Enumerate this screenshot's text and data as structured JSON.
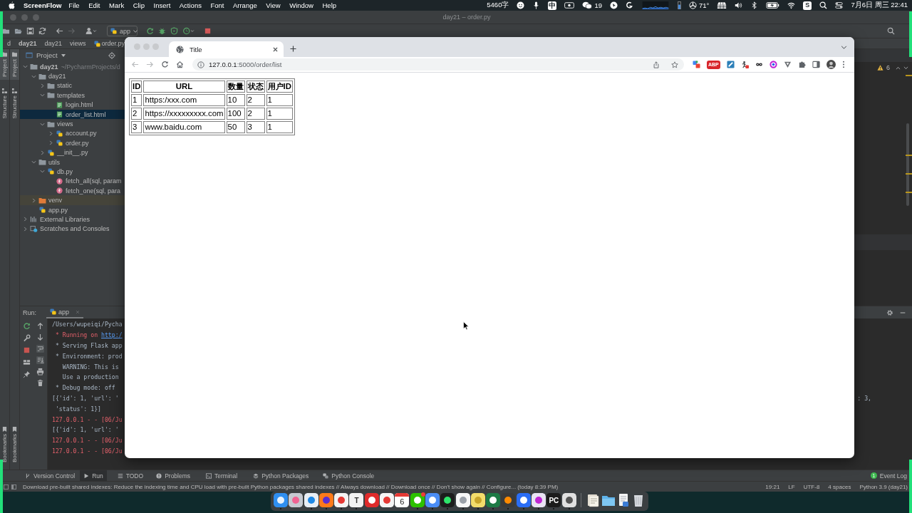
{
  "menu_bar": {
    "app_name": "ScreenFlow",
    "menus": [
      "File",
      "Edit",
      "Mark",
      "Clip",
      "Insert",
      "Actions",
      "Font",
      "Arrange",
      "View",
      "Window",
      "Help"
    ],
    "word_count": "5460字",
    "input_method": "中",
    "chat_badge": "19",
    "temperature": "71°",
    "status_tile": "S",
    "clock": "7月6日 周三 22:41"
  },
  "ide": {
    "title": "day21 – order.py",
    "run_config": "app",
    "breadcrumbs": [
      {
        "label": "d",
        "kind": "folder"
      },
      {
        "label": "day21",
        "kind": "project"
      },
      {
        "label": "day21",
        "kind": "folder"
      },
      {
        "label": "views",
        "kind": "folder"
      },
      {
        "label": "order.py",
        "kind": "file"
      }
    ],
    "tool_strips": [
      {
        "top": [
          {
            "label": "Project",
            "selected": true
          },
          {
            "label": "Structure",
            "selected": false
          }
        ],
        "bottom": [
          {
            "label": "Bookmarks",
            "selected": false
          }
        ]
      },
      {
        "top": [
          {
            "label": "Project",
            "selected": true
          },
          {
            "label": "Structure",
            "selected": false
          }
        ],
        "bottom": [
          {
            "label": "Bookmarks",
            "selected": false
          }
        ]
      }
    ],
    "project": {
      "title": "Project",
      "tree": [
        {
          "name": "day21",
          "hint": "~/PycharmProjects/d",
          "kind": "module",
          "expanded": true,
          "selected": false,
          "children": [
            {
              "name": "day21",
              "kind": "folder",
              "expanded": true,
              "selected": false,
              "children": [
                {
                  "name": "static",
                  "kind": "folder",
                  "expanded": false,
                  "selected": false
                },
                {
                  "name": "templates",
                  "kind": "folder",
                  "expanded": true,
                  "selected": false,
                  "children": [
                    {
                      "name": "login.html",
                      "kind": "html",
                      "selected": false
                    },
                    {
                      "name": "order_list.html",
                      "kind": "html",
                      "selected": true
                    }
                  ]
                },
                {
                  "name": "views",
                  "kind": "folder",
                  "expanded": true,
                  "selected": false,
                  "children": [
                    {
                      "name": "account.py",
                      "kind": "python",
                      "expanded": false,
                      "selected": false
                    },
                    {
                      "name": "order.py",
                      "kind": "python",
                      "expanded": false,
                      "selected": false
                    }
                  ]
                },
                {
                  "name": "__init__.py",
                  "kind": "python",
                  "expanded": false,
                  "selected": false
                }
              ]
            },
            {
              "name": "utils",
              "kind": "folder",
              "expanded": true,
              "selected": false,
              "children": [
                {
                  "name": "db.py",
                  "kind": "python",
                  "expanded": true,
                  "selected": false,
                  "children": [
                    {
                      "name": "fetch_all(sql, param",
                      "kind": "function",
                      "selected": false
                    },
                    {
                      "name": "fetch_one(sql, para",
                      "kind": "function",
                      "selected": false
                    }
                  ]
                }
              ]
            },
            {
              "name": "venv",
              "kind": "excluded",
              "expanded": false,
              "selected": false
            },
            {
              "name": "app.py",
              "kind": "python",
              "selected": false
            }
          ]
        },
        {
          "name": "External Libraries",
          "kind": "libraries",
          "expanded": false,
          "selected": false
        },
        {
          "name": "Scratches and Consoles",
          "kind": "scratches",
          "expanded": false,
          "selected": false
        }
      ]
    },
    "warnings": "6",
    "run": {
      "label": "Run:",
      "tab": "app",
      "lines": [
        {
          "parts": [
            {
              "text": "/Users/wupeiqi/Pycha",
              "kind": "plain"
            }
          ]
        },
        {
          "parts": [
            {
              "text": " * Running on ",
              "kind": "error"
            },
            {
              "text": "http:/",
              "kind": "link"
            }
          ]
        },
        {
          "parts": [
            {
              "text": " * Serving Flask app",
              "kind": "plain"
            }
          ]
        },
        {
          "parts": [
            {
              "text": " * Environment: prod",
              "kind": "plain"
            }
          ]
        },
        {
          "parts": [
            {
              "text": "   WARNING: This is",
              "kind": "plain"
            }
          ]
        },
        {
          "parts": [
            {
              "text": "   Use a production",
              "kind": "plain"
            }
          ]
        },
        {
          "parts": [
            {
              "text": " * Debug mode: off",
              "kind": "plain"
            }
          ]
        },
        {
          "parts": [
            {
              "text": "[{'id': 1, 'url': '",
              "kind": "plain"
            }
          ],
          "tail": ": 3,"
        },
        {
          "parts": [
            {
              "text": " 'status': 1}]",
              "kind": "plain"
            }
          ]
        },
        {
          "parts": [
            {
              "text": "127.0.0.1 - - [06/Ju",
              "kind": "error"
            }
          ]
        },
        {
          "parts": [
            {
              "text": "[{'id': 1, 'url': '",
              "kind": "plain"
            }
          ]
        },
        {
          "parts": [
            {
              "text": "127.0.0.1 - - [06/Ju",
              "kind": "error"
            }
          ]
        },
        {
          "parts": [
            {
              "text": "127.0.0.1 - - [06/Ju",
              "kind": "error"
            }
          ]
        }
      ]
    },
    "tool_tabs": [
      {
        "label": "Version Control",
        "kind": "vcs",
        "selected": false
      },
      {
        "label": "Run",
        "kind": "run",
        "selected": true
      },
      {
        "label": "TODO",
        "kind": "todo",
        "selected": false
      },
      {
        "label": "Problems",
        "kind": "problems",
        "selected": false
      },
      {
        "label": "Terminal",
        "kind": "terminal",
        "selected": false
      },
      {
        "label": "Python Packages",
        "kind": "packages",
        "selected": false
      },
      {
        "label": "Python Console",
        "kind": "console",
        "selected": false
      }
    ],
    "event_log": {
      "label": "Event Log",
      "badge": "1"
    },
    "status": {
      "message": "Download pre-built shared indexes: Reduce the indexing time and CPU load with pre-built Python packages shared indexes // Always download // Download once // Don't show again // Configure... (today 8:39 PM)",
      "items": [
        "19:21",
        "LF",
        "UTF-8",
        "4 spaces",
        "Python 3.9 (day21)"
      ]
    }
  },
  "browser": {
    "tab_title": "Title",
    "url_host": "127.0.0.1",
    "url_path": ":5000/order/list",
    "adblock_label": "ABP",
    "table": {
      "columns": [
        "ID",
        "URL",
        "数量",
        "状态",
        "用户ID"
      ],
      "rows": [
        [
          "1",
          "https:/xxx.com",
          "10",
          "2",
          "1"
        ],
        [
          "2",
          "https://xxxxxxxxx.com",
          "100",
          "2",
          "1"
        ],
        [
          "3",
          "www.baidu.com",
          "50",
          "3",
          "1"
        ]
      ]
    }
  },
  "dock": {
    "apps": [
      {
        "kind": "app",
        "running": true,
        "badge": false
      },
      {
        "kind": "app",
        "running": false,
        "badge": false
      },
      {
        "kind": "app",
        "running": true,
        "badge": false
      },
      {
        "kind": "app",
        "running": true,
        "badge": false
      },
      {
        "kind": "app",
        "running": true,
        "badge": false
      },
      {
        "kind": "letter",
        "label": "T",
        "running": true,
        "badge": false
      },
      {
        "kind": "app",
        "running": false,
        "badge": false
      },
      {
        "kind": "app",
        "running": false,
        "badge": false
      },
      {
        "kind": "calendar",
        "label": "6",
        "running": false,
        "badge": false
      },
      {
        "kind": "app",
        "running": true,
        "badge": true
      },
      {
        "kind": "app",
        "running": true,
        "badge": false
      },
      {
        "kind": "app",
        "running": true,
        "badge": false
      },
      {
        "kind": "app",
        "running": true,
        "badge": false
      },
      {
        "kind": "app",
        "running": true,
        "badge": false
      },
      {
        "kind": "app",
        "running": true,
        "badge": false
      },
      {
        "kind": "app",
        "running": true,
        "badge": false
      },
      {
        "kind": "app",
        "running": true,
        "badge": false
      },
      {
        "kind": "app",
        "running": true,
        "badge": false
      },
      {
        "kind": "letter",
        "label": "PC",
        "running": true,
        "badge": false
      },
      {
        "kind": "app",
        "running": true,
        "badge": false
      }
    ],
    "stacks": [
      {
        "kind": "stack"
      },
      {
        "kind": "folder"
      },
      {
        "kind": "document"
      },
      {
        "kind": "trash"
      }
    ]
  }
}
